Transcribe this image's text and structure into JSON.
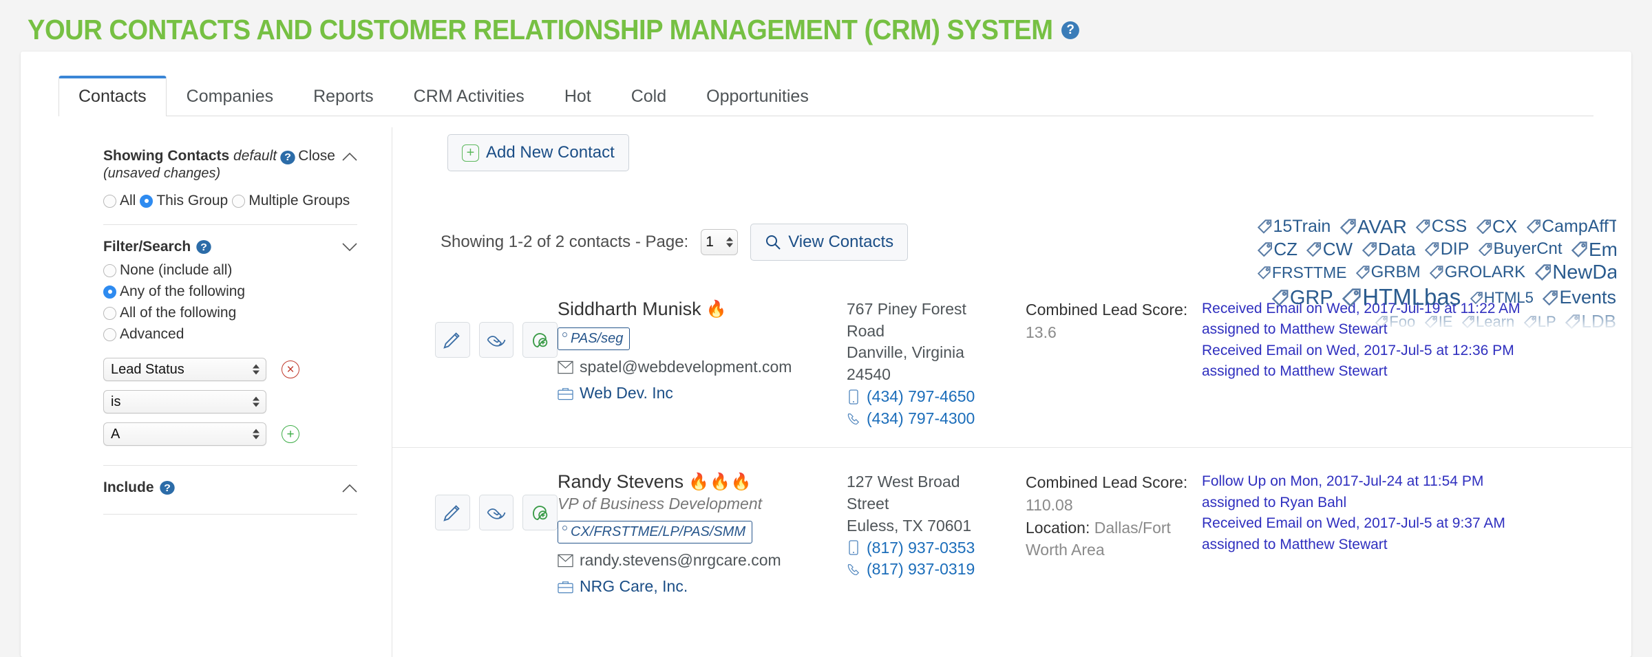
{
  "page": {
    "title": "YOUR CONTACTS AND CUSTOMER RELATIONSHIP MANAGEMENT (CRM) SYSTEM",
    "help_glyph": "?",
    "accent_green": "#76c043",
    "accent_blue": "#3a86d6",
    "link_blue": "#1b4e86",
    "activity_blue": "#2f2fbf"
  },
  "tabs": [
    {
      "label": "Contacts",
      "active": true
    },
    {
      "label": "Companies",
      "active": false
    },
    {
      "label": "Reports",
      "active": false
    },
    {
      "label": "CRM Activities",
      "active": false
    },
    {
      "label": "Hot",
      "active": false
    },
    {
      "label": "Cold",
      "active": false
    },
    {
      "label": "Opportunities",
      "active": false
    }
  ],
  "sidebar": {
    "showing_label": "Showing Contacts",
    "showing_mode": "default",
    "unsaved": "(unsaved changes)",
    "close_label": "Close",
    "scope_radios": [
      {
        "label": "All",
        "selected": false
      },
      {
        "label": "This Group",
        "selected": true
      },
      {
        "label": "Multiple Groups",
        "selected": false
      }
    ],
    "filter_section": {
      "title": "Filter/Search",
      "options": [
        {
          "label": "None (include all)",
          "selected": false
        },
        {
          "label": "Any of the following",
          "selected": true
        },
        {
          "label": "All of the following",
          "selected": false
        },
        {
          "label": "Advanced",
          "selected": false
        }
      ],
      "field_select": "Lead Status",
      "operator_select": "is",
      "value_select": "A",
      "remove_glyph": "×",
      "add_glyph": "+"
    },
    "include_section": {
      "title": "Include"
    }
  },
  "toolbar": {
    "add_contact_label": "Add New Contact",
    "add_contact_glyph": "+",
    "showing_text": "Showing 1-2 of 2 contacts - Page:",
    "page_value": "1",
    "view_contacts_label": "View Contacts"
  },
  "contacts": [
    {
      "name": "Siddharth Munisk",
      "flames": "🔥",
      "job_title": "",
      "tag": "PAS/seg",
      "email": "spatel@webdevelopment.com",
      "company": "Web Dev. Inc",
      "address_lines": [
        "767 Piney Forest",
        "Road",
        "Danville, Virginia",
        "24540"
      ],
      "mobile": "(434) 797-4650",
      "phone": "(434) 797-4300",
      "lead_score_label": "Combined Lead Score:",
      "lead_score": "13.6",
      "location_label": "",
      "location": "",
      "activities": [
        "Received Email on Wed, 2017-Jul-19 at 11:22 AM",
        "assigned to Matthew Stewart",
        "Received Email on Wed, 2017-Jul-5 at 12:36 PM",
        "assigned to Matthew Stewart"
      ]
    },
    {
      "name": "Randy Stevens",
      "flames": "🔥🔥🔥",
      "job_title": "VP of Business Development",
      "tag": "CX/FRSTTME/LP/PAS/SMM",
      "email": "randy.stevens@nrgcare.com",
      "company": "NRG Care, Inc.",
      "address_lines": [
        "127 West Broad",
        "Street",
        "Euless, TX 70601"
      ],
      "mobile": "(817) 937-0353",
      "phone": "(817) 937-0319",
      "lead_score_label": "Combined Lead Score:",
      "lead_score": "110.08",
      "location_label": "Location:",
      "location": "Dallas/Fort Worth Area",
      "activities": [
        "Follow Up on Mon, 2017-Jul-24 at 11:54 PM",
        "assigned to Ryan Bahl",
        "Received Email on Wed, 2017-Jul-5 at 9:37 AM",
        "assigned to Matthew Stewart"
      ]
    }
  ],
  "tag_cloud": {
    "lines": [
      [
        {
          "label": "15Train",
          "size": 25
        },
        {
          "label": "AVAR",
          "size": 28
        },
        {
          "label": "CSS",
          "size": 25
        },
        {
          "label": "CX",
          "size": 26
        },
        {
          "label": "CampAffT",
          "size": 25
        }
      ],
      [
        {
          "label": "CZ",
          "size": 26
        },
        {
          "label": "CW",
          "size": 26
        },
        {
          "label": "Data",
          "size": 26
        },
        {
          "label": "DIP",
          "size": 25
        },
        {
          "label": "BuyerCnt",
          "size": 24
        },
        {
          "label": "Email",
          "size": 28
        }
      ],
      [
        {
          "label": "FRSTTME",
          "size": 23
        },
        {
          "label": "GRBM",
          "size": 24
        },
        {
          "label": "GROLARK",
          "size": 24
        },
        {
          "label": "NewDash",
          "size": 29
        }
      ],
      [
        {
          "label": "GRP",
          "size": 29
        },
        {
          "label": "HTMLbas",
          "size": 33
        },
        {
          "label": "HTML5",
          "size": 22
        },
        {
          "label": "Events",
          "size": 27
        }
      ],
      [
        {
          "label": "Foo",
          "size": 22
        },
        {
          "label": "IE",
          "size": 22
        },
        {
          "label": "Learn",
          "size": 22
        },
        {
          "label": "LP",
          "size": 22
        },
        {
          "label": "LDB",
          "size": 26
        }
      ]
    ]
  },
  "icons": {
    "edit": "pencil-icon",
    "deal": "handshake-icon",
    "add_to_group": "hand-plus-icon",
    "email": "envelope-icon",
    "company": "briefcase-icon",
    "mobile": "mobile-phone-icon",
    "phone": "telephone-icon",
    "search": "search-icon",
    "tag": "tag-icon"
  }
}
